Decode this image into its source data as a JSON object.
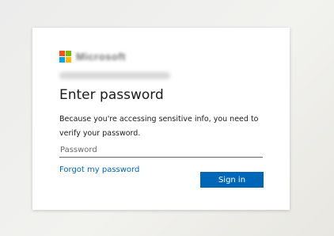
{
  "brand": {
    "logo_text": "Microsoft",
    "logo_colors": [
      "#f25022",
      "#7fba00",
      "#00a4ef",
      "#ffb900"
    ]
  },
  "login": {
    "title": "Enter password",
    "description": "Because you're accessing sensitive info, you need to verify your password.",
    "password_placeholder": "Password",
    "password_value": "",
    "forgot_link": "Forgot my password",
    "signin_label": "Sign in"
  },
  "colors": {
    "accent": "#0067b8",
    "link": "#0067b8",
    "card_bg": "#ffffff"
  }
}
